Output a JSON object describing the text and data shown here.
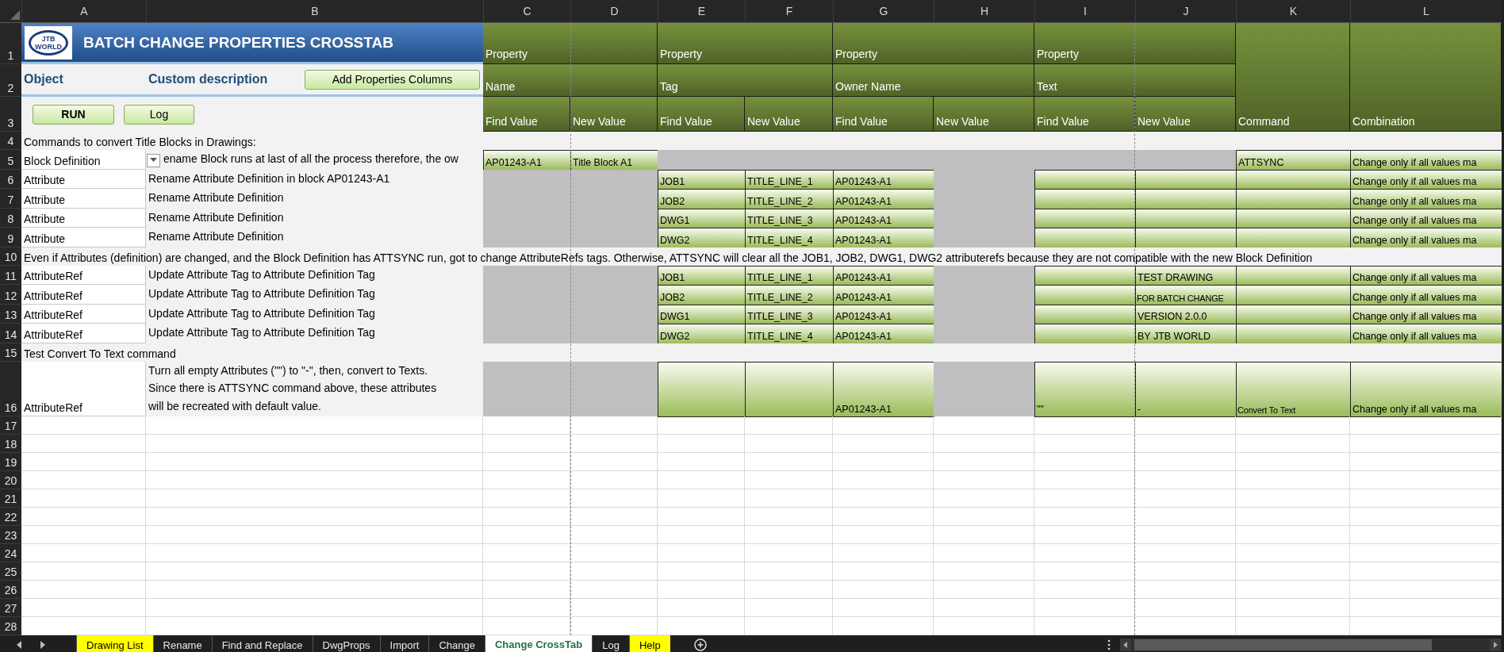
{
  "column_headers": [
    "A",
    "B",
    "C",
    "D",
    "E",
    "F",
    "G",
    "H",
    "I",
    "J",
    "K",
    "L"
  ],
  "header_row_numbers": [
    "1",
    "2",
    "3"
  ],
  "title_block": {
    "logo_lines": [
      "JTB",
      "WORLD"
    ],
    "title": "BATCH CHANGE PROPERTIES CROSSTAB"
  },
  "header_labels": {
    "object": "Object",
    "description": "Custom description"
  },
  "add_columns_button": {
    "label": "Add Properties Columns"
  },
  "buttons": [
    {
      "label": "RUN",
      "bold": true
    },
    {
      "label": "Log",
      "bold": false
    }
  ],
  "property_groups": [
    {
      "property": "Property",
      "name": "Name",
      "find": "Find Value",
      "new": "New Value"
    },
    {
      "property": "Property",
      "name": "Tag",
      "find": "Find Value",
      "new": "New Value"
    },
    {
      "property": "Property",
      "name": "Owner Name",
      "find": "Find Value",
      "new": "New Value"
    },
    {
      "property": "Property",
      "name": "Text",
      "find": "Find Value",
      "new": "New Value"
    }
  ],
  "extra_columns": [
    "Command",
    "Combination"
  ],
  "rows": [
    {
      "number": "4",
      "kind": "note",
      "text": "Commands to convert Title Blocks in Drawings:"
    },
    {
      "number": "5",
      "kind": "data",
      "object": "Block Definition",
      "dropdown": true,
      "description": "ename Block runs at last of all the process therefore, the ow",
      "cells": [
        {
          "kind": "entry",
          "text": "AP01243-A1"
        },
        {
          "kind": "entry",
          "text": "Title Block A1"
        },
        {
          "kind": "shaded"
        },
        {
          "kind": "shaded"
        },
        {
          "kind": "shaded"
        },
        {
          "kind": "shaded"
        },
        {
          "kind": "shaded"
        },
        {
          "kind": "shaded"
        },
        {
          "kind": "entry",
          "text": "ATTSYNC"
        },
        {
          "kind": "entry",
          "text": "Change only if all values ma"
        }
      ]
    },
    {
      "number": "6",
      "kind": "data",
      "object": "Attribute",
      "description": "Rename Attribute Definition in block AP01243-A1",
      "cells": [
        {
          "kind": "shaded"
        },
        {
          "kind": "shaded"
        },
        {
          "kind": "entry",
          "text": "JOB1"
        },
        {
          "kind": "entry",
          "text": "TITLE_LINE_1"
        },
        {
          "kind": "entry",
          "text": "AP01243-A1"
        },
        {
          "kind": "shaded"
        },
        {
          "kind": "entry"
        },
        {
          "kind": "entry"
        },
        {
          "kind": "entry"
        },
        {
          "kind": "entry",
          "text": "Change only if all values ma"
        }
      ]
    },
    {
      "number": "7",
      "kind": "data",
      "object": "Attribute",
      "description": "Rename Attribute Definition",
      "cells": [
        {
          "kind": "shaded"
        },
        {
          "kind": "shaded"
        },
        {
          "kind": "entry",
          "text": "JOB2"
        },
        {
          "kind": "entry",
          "text": "TITLE_LINE_2"
        },
        {
          "kind": "entry",
          "text": "AP01243-A1"
        },
        {
          "kind": "shaded"
        },
        {
          "kind": "entry"
        },
        {
          "kind": "entry"
        },
        {
          "kind": "entry"
        },
        {
          "kind": "entry",
          "text": "Change only if all values ma"
        }
      ]
    },
    {
      "number": "8",
      "kind": "data",
      "object": "Attribute",
      "description": "Rename Attribute Definition",
      "cells": [
        {
          "kind": "shaded"
        },
        {
          "kind": "shaded"
        },
        {
          "kind": "entry",
          "text": "DWG1"
        },
        {
          "kind": "entry",
          "text": "TITLE_LINE_3"
        },
        {
          "kind": "entry",
          "text": "AP01243-A1"
        },
        {
          "kind": "shaded"
        },
        {
          "kind": "entry"
        },
        {
          "kind": "entry"
        },
        {
          "kind": "entry"
        },
        {
          "kind": "entry",
          "text": "Change only if all values ma"
        }
      ]
    },
    {
      "number": "9",
      "kind": "data",
      "object": "Attribute",
      "description": "Rename Attribute Definition",
      "cells": [
        {
          "kind": "shaded"
        },
        {
          "kind": "shaded"
        },
        {
          "kind": "entry",
          "text": "DWG2"
        },
        {
          "kind": "entry",
          "text": "TITLE_LINE_4"
        },
        {
          "kind": "entry",
          "text": "AP01243-A1"
        },
        {
          "kind": "shaded"
        },
        {
          "kind": "entry"
        },
        {
          "kind": "entry"
        },
        {
          "kind": "entry"
        },
        {
          "kind": "entry",
          "text": "Change only if all values ma"
        }
      ]
    },
    {
      "number": "10",
      "kind": "note",
      "text": "Even if Attributes (definition) are changed, and the Block Definition has ATTSYNC run, got to change AttributeRefs tags. Otherwise, ATTSYNC will clear all the JOB1, JOB2, DWG1, DWG2 attributerefs because they are not compatible with the new Block Definition"
    },
    {
      "number": "11",
      "kind": "data",
      "object": "AttributeRef",
      "description": "Update Attribute Tag to Attribute Definition Tag",
      "cells": [
        {
          "kind": "shaded"
        },
        {
          "kind": "shaded"
        },
        {
          "kind": "entry",
          "text": "JOB1"
        },
        {
          "kind": "entry",
          "text": "TITLE_LINE_1"
        },
        {
          "kind": "entry",
          "text": "AP01243-A1"
        },
        {
          "kind": "shaded"
        },
        {
          "kind": "entry"
        },
        {
          "kind": "entry",
          "text": "TEST DRAWING"
        },
        {
          "kind": "entry"
        },
        {
          "kind": "entry",
          "text": "Change only if all values ma"
        }
      ]
    },
    {
      "number": "12",
      "kind": "data",
      "object": "AttributeRef",
      "description": "Update Attribute Tag to Attribute Definition Tag",
      "cells": [
        {
          "kind": "shaded"
        },
        {
          "kind": "shaded"
        },
        {
          "kind": "entry",
          "text": "JOB2"
        },
        {
          "kind": "entry",
          "text": "TITLE_LINE_2"
        },
        {
          "kind": "entry",
          "text": "AP01243-A1"
        },
        {
          "kind": "shaded"
        },
        {
          "kind": "entry"
        },
        {
          "kind": "entry",
          "text": "FOR BATCH CHANGE"
        },
        {
          "kind": "entry"
        },
        {
          "kind": "entry",
          "text": "Change only if all values ma"
        }
      ]
    },
    {
      "number": "13",
      "kind": "data",
      "object": "AttributeRef",
      "description": "Update Attribute Tag to Attribute Definition Tag",
      "cells": [
        {
          "kind": "shaded"
        },
        {
          "kind": "shaded"
        },
        {
          "kind": "entry",
          "text": "DWG1"
        },
        {
          "kind": "entry",
          "text": "TITLE_LINE_3"
        },
        {
          "kind": "entry",
          "text": "AP01243-A1"
        },
        {
          "kind": "shaded"
        },
        {
          "kind": "entry"
        },
        {
          "kind": "entry",
          "text": "VERSION 2.0.0"
        },
        {
          "kind": "entry"
        },
        {
          "kind": "entry",
          "text": "Change only if all values ma"
        }
      ]
    },
    {
      "number": "14",
      "kind": "data",
      "object": "AttributeRef",
      "description": "Update Attribute Tag to Attribute Definition Tag",
      "cells": [
        {
          "kind": "shaded"
        },
        {
          "kind": "shaded"
        },
        {
          "kind": "entry",
          "text": "DWG2"
        },
        {
          "kind": "entry",
          "text": "TITLE_LINE_4"
        },
        {
          "kind": "entry",
          "text": "AP01243-A1"
        },
        {
          "kind": "shaded"
        },
        {
          "kind": "entry"
        },
        {
          "kind": "entry",
          "text": "BY JTB WORLD"
        },
        {
          "kind": "entry"
        },
        {
          "kind": "entry",
          "text": "Change only if all values ma"
        }
      ]
    },
    {
      "number": "15",
      "kind": "note",
      "text": "Test Convert To Text command"
    },
    {
      "number": "16",
      "kind": "data",
      "object": "AttributeRef",
      "description": "Turn all empty Attributes (\"\") to \"-\", then, convert to Texts.\nSince there is ATTSYNC command above, these attributes\nwill be recreated with default value.",
      "cells": [
        {
          "kind": "shaded"
        },
        {
          "kind": "shaded"
        },
        {
          "kind": "entry"
        },
        {
          "kind": "entry"
        },
        {
          "kind": "entry",
          "text": "AP01243-A1"
        },
        {
          "kind": "shaded"
        },
        {
          "kind": "entry",
          "text": "\"\""
        },
        {
          "kind": "entry",
          "text": "-"
        },
        {
          "kind": "entry",
          "text": "Convert To Text"
        },
        {
          "kind": "entry",
          "text": "Change only if all values ma"
        }
      ]
    },
    {
      "number": "17",
      "kind": "empty"
    },
    {
      "number": "18",
      "kind": "empty"
    },
    {
      "number": "19",
      "kind": "empty"
    },
    {
      "number": "20",
      "kind": "empty"
    },
    {
      "number": "21",
      "kind": "empty"
    },
    {
      "number": "22",
      "kind": "empty"
    },
    {
      "number": "23",
      "kind": "empty"
    },
    {
      "number": "24",
      "kind": "empty"
    },
    {
      "number": "25",
      "kind": "empty"
    },
    {
      "number": "26",
      "kind": "empty"
    },
    {
      "number": "27",
      "kind": "empty"
    },
    {
      "number": "28",
      "kind": "empty"
    }
  ],
  "sheet_tabs": [
    {
      "label": "Drawing List",
      "selected": false,
      "color": "#ffff00"
    },
    {
      "label": "Rename",
      "selected": false
    },
    {
      "label": "Find and Replace",
      "selected": false
    },
    {
      "label": "DwgProps",
      "selected": false
    },
    {
      "label": "Import",
      "selected": false
    },
    {
      "label": "Change",
      "selected": false
    },
    {
      "label": "Change CrossTab",
      "selected": true
    },
    {
      "label": "Log",
      "selected": false
    },
    {
      "label": "Help",
      "selected": false,
      "color": "#ffff00"
    }
  ]
}
